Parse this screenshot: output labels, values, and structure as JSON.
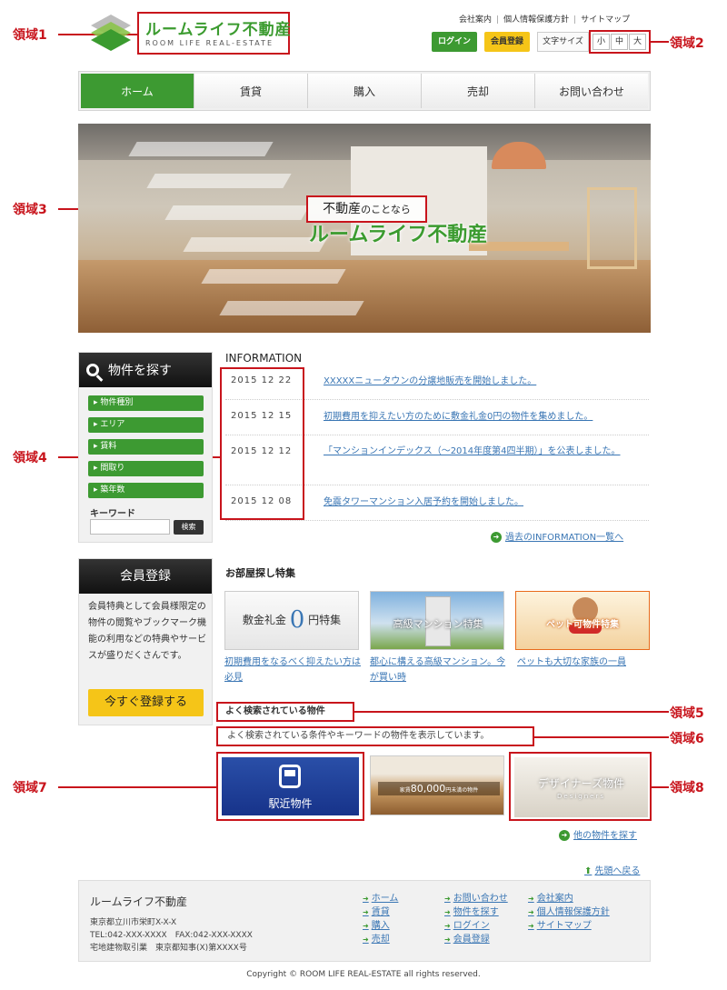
{
  "annotations": {
    "r1": "領域1",
    "r2": "領域2",
    "r3": "領域3",
    "r4": "領域4",
    "r5": "領域5",
    "r6": "領域6",
    "r7": "領域7",
    "r8": "領域8"
  },
  "logo": {
    "jp": "ルームライフ不動産",
    "en": "ROOM LIFE REAL-ESTATE"
  },
  "top_links": [
    "会社案内",
    "個人情報保護方針",
    "サイトマップ"
  ],
  "header_buttons": {
    "login": "ログイン",
    "member": "会員登録"
  },
  "font_size": {
    "label": "文字サイズ",
    "small": "小",
    "medium": "中",
    "large": "大"
  },
  "nav": [
    "ホーム",
    "賃貸",
    "購入",
    "売却",
    "お問い合わせ"
  ],
  "hero": {
    "tagline_main": "不動産",
    "tagline_sub": "のことなら",
    "title": "ルームライフ不動産"
  },
  "search": {
    "heading": "物件を探す",
    "categories": [
      "物件種別",
      "エリア",
      "賃料",
      "間取り",
      "築年数"
    ],
    "keyword_label": "キーワード",
    "search_btn": "検索"
  },
  "info": {
    "title": "INFORMATION",
    "items": [
      {
        "date": "2015 12 22",
        "text": "XXXXXニュータウンの分譲地販売を開始しました。"
      },
      {
        "date": "2015 12 15",
        "text": "初期費用を抑えたい方のために敷金礼金0円の物件を集めました。"
      },
      {
        "date": "2015 12 12",
        "text": "「マンションインデックス（～2014年度第4四半期）」を公表しました。"
      },
      {
        "date": "2015 12 08",
        "text": "免震タワーマンション入居予約を開始しました。"
      }
    ],
    "more": "過去のINFORMATION一覧へ"
  },
  "member": {
    "heading": "会員登録",
    "text": "会員特典として会員様限定の物件の閲覧やブックマーク機能の利用などの特典やサービスが盛りだくさんです。",
    "button": "今すぐ登録する"
  },
  "features": {
    "title": "お部屋探し特集",
    "f1": {
      "pre": "敷金礼金",
      "num": "0",
      "post": "円特集",
      "caption": "初期費用をなるべく抑えたい方は必見"
    },
    "f2": {
      "label": "高級マンション特集",
      "caption": "都心に構える高級マンション。今が買い時"
    },
    "f3": {
      "label": "ペット可物件特集",
      "caption": "ペットも大切な家族の一員"
    }
  },
  "popular": {
    "title": "よく検索されている物件",
    "desc": "よく検索されている条件やキーワードの物件を表示しています。",
    "p1": "駅近物件",
    "p2_pre": "家賃",
    "p2_num": "80,000",
    "p2_post": "円未満の物件",
    "p3": "デザイナーズ物件",
    "p3_sub": "Designers",
    "more": "他の物件を探す"
  },
  "back_top": "先頭へ戻る",
  "footer": {
    "name": "ルームライフ不動産",
    "addr1": "東京都立川市栄町X-X-X",
    "addr2": "TEL:042-XXX-XXXX　FAX:042-XXX-XXXX",
    "addr3": "宅地建物取引業　東京都知事(X)第XXXX号",
    "col1": [
      "ホーム",
      "賃貸",
      "購入",
      "売却"
    ],
    "col2": [
      "お問い合わせ",
      "物件を探す",
      "ログイン",
      "会員登録"
    ],
    "col3": [
      "会社案内",
      "個人情報保護方針",
      "サイトマップ"
    ]
  },
  "copyright": "Copyright © ROOM LIFE REAL-ESTATE all rights reserved."
}
